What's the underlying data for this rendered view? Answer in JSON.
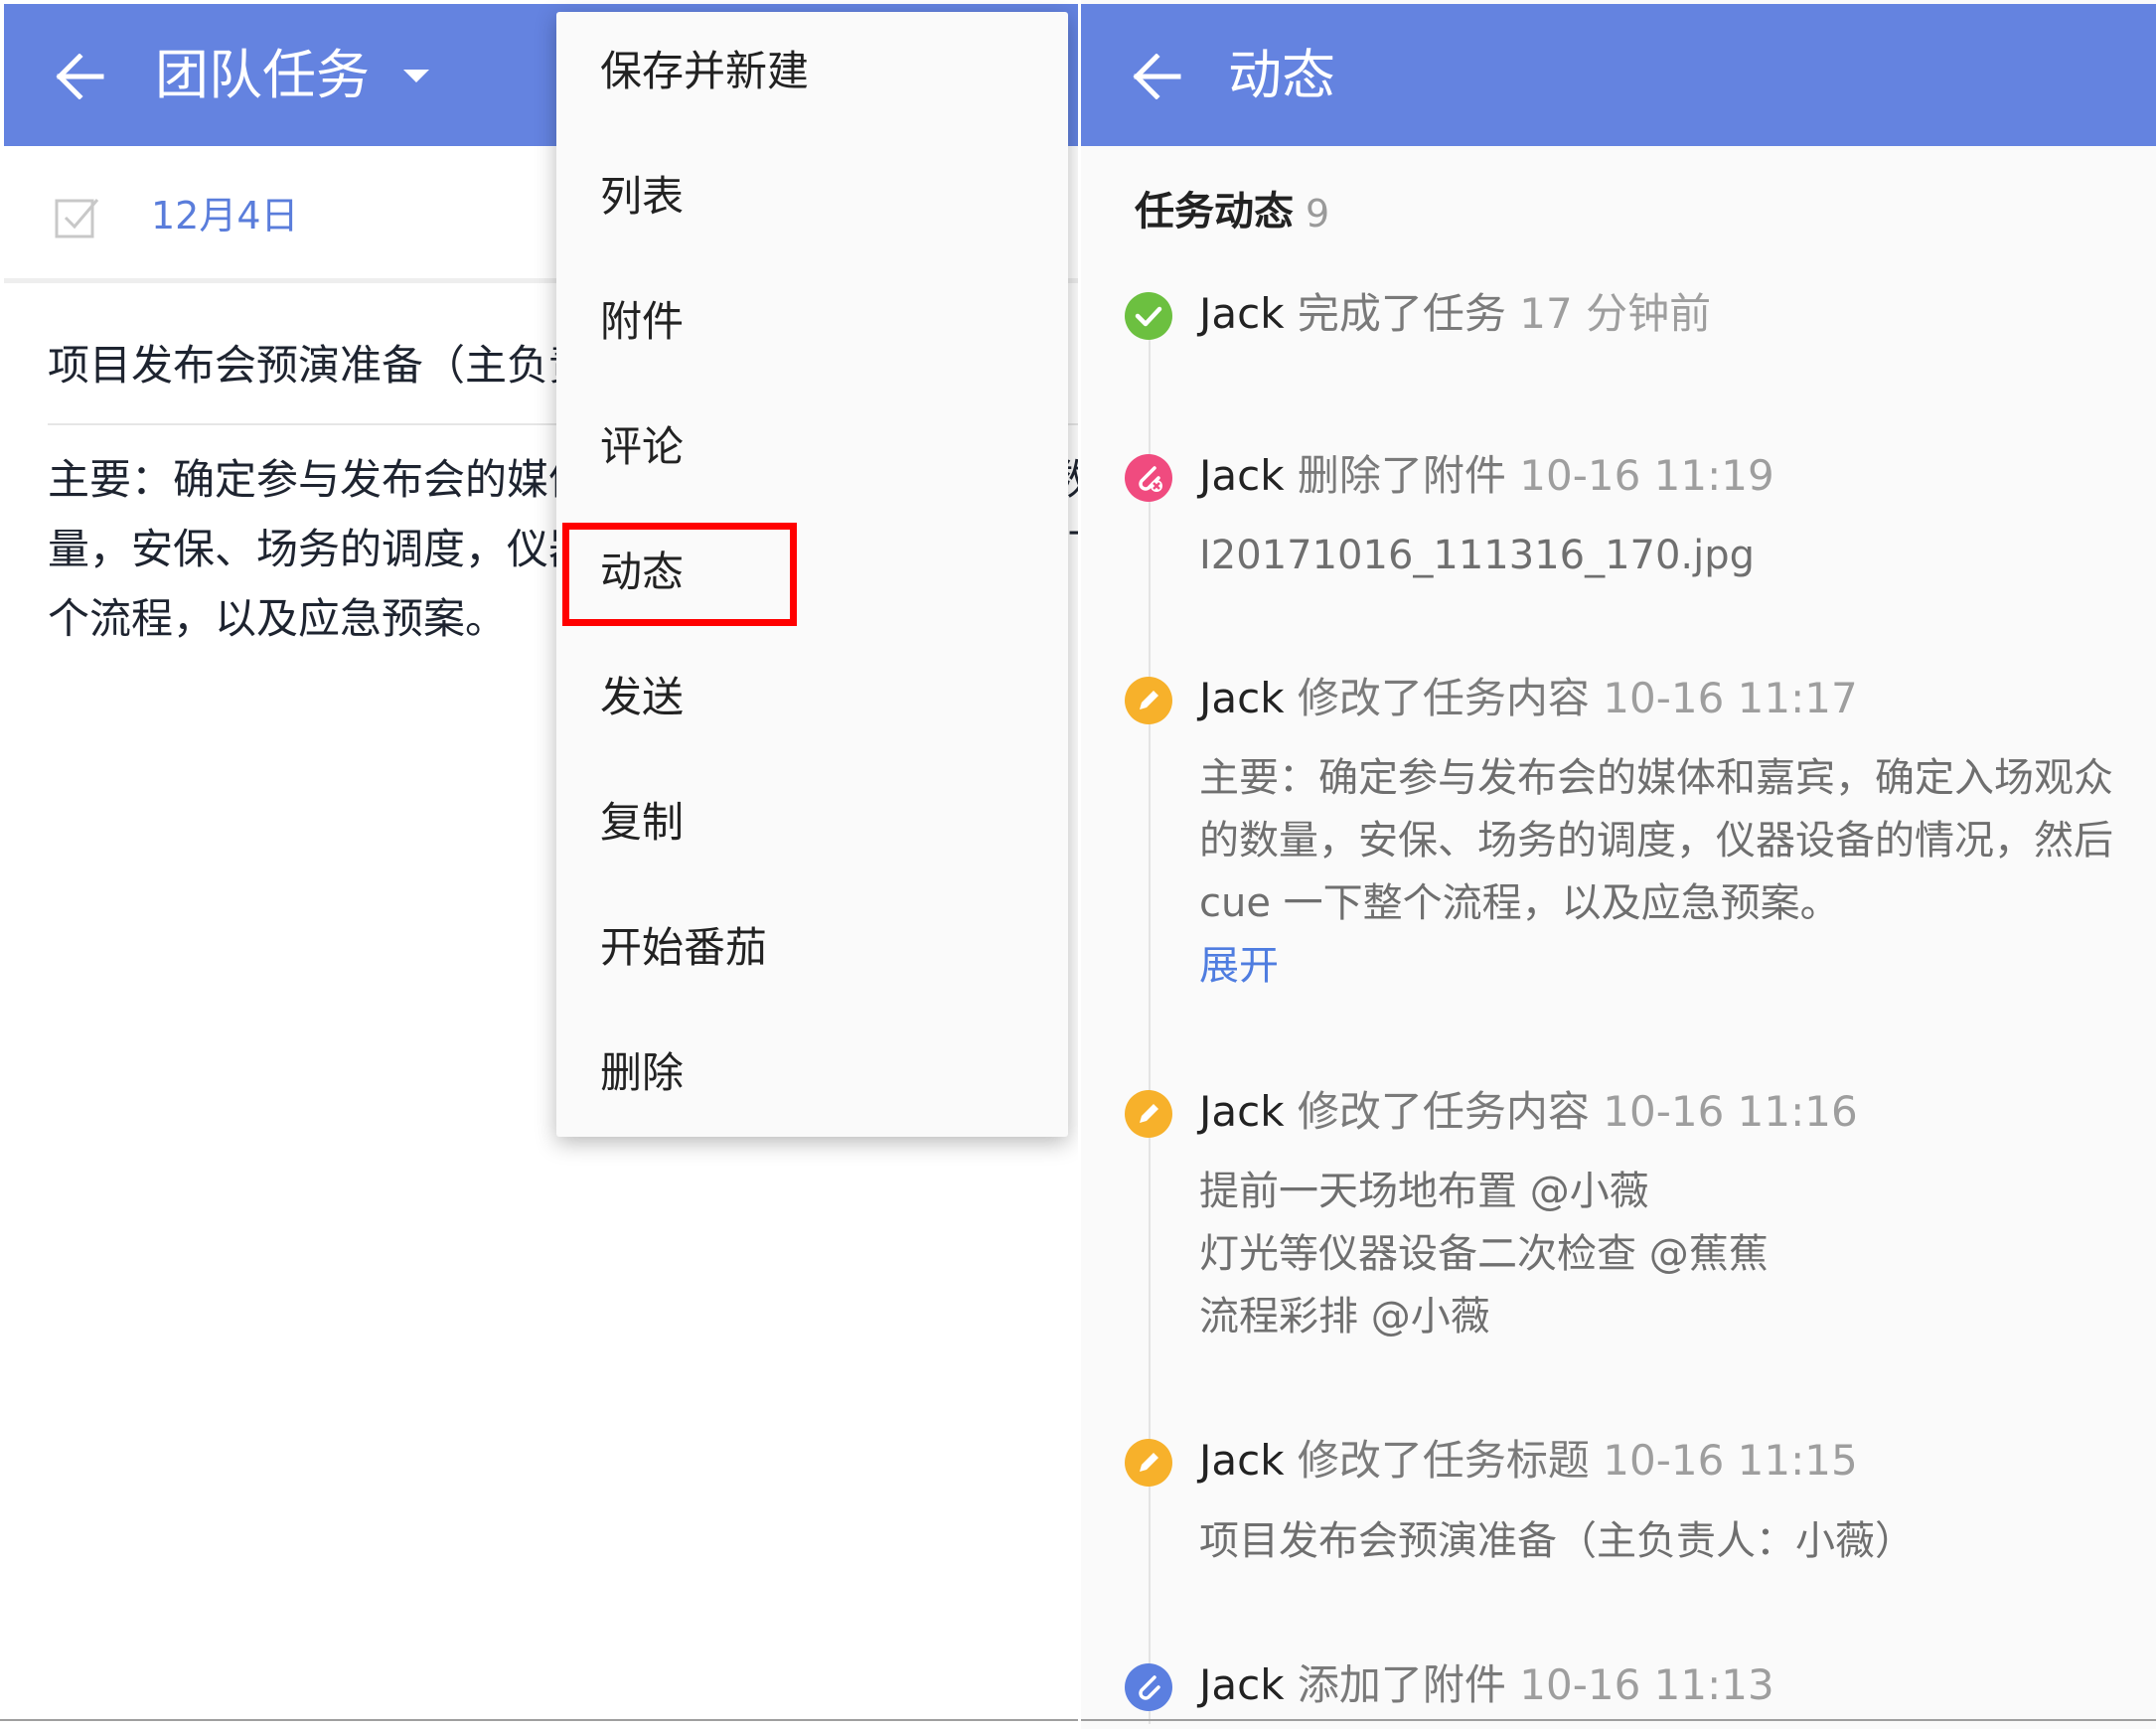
{
  "left": {
    "header": {
      "title": "团队任务"
    },
    "date": "12月4日",
    "task_title": "项目发布会预演准备（主负责人：小薇）",
    "task_description": "主要：确定参与发布会的媒体和嘉宾，确定入场观众的数量，安保、场务的调度，仪器设备的情况，然后 cue 一下整个流程，以及应急预案。",
    "menu": {
      "items": [
        "保存并新建",
        "列表",
        "附件",
        "评论",
        "动态",
        "发送",
        "复制",
        "开始番茄",
        "删除"
      ],
      "highlighted": "动态"
    }
  },
  "right": {
    "header": {
      "title": "动态"
    },
    "section": {
      "title": "任务动态",
      "count": "9"
    },
    "activities": [
      {
        "icon": "check-circle-icon",
        "color": "#6cc040",
        "user": "Jack",
        "action": "完成了任务",
        "time": "17 分钟前"
      },
      {
        "icon": "attachment-remove-icon",
        "color": "#f04b7f",
        "user": "Jack",
        "action": "删除了附件",
        "time": "10-16 11:19",
        "body": "I20171016_111316_170.jpg"
      },
      {
        "icon": "pencil-icon",
        "color": "#f7b12b",
        "user": "Jack",
        "action": "修改了任务内容",
        "time": "10-16 11:17",
        "body": "主要：确定参与发布会的媒体和嘉宾，确定入场观众的数量，安保、场务的调度，仪器设备的情况，然后 cue 一下整个流程，以及应急预案。",
        "link": "展开"
      },
      {
        "icon": "pencil-icon",
        "color": "#f7b12b",
        "user": "Jack",
        "action": "修改了任务内容",
        "time": "10-16 11:16",
        "body_lines": [
          "提前一天场地布置 @小薇",
          "灯光等仪器设备二次检查 @蕉蕉",
          "流程彩排 @小薇"
        ]
      },
      {
        "icon": "pencil-icon",
        "color": "#f7b12b",
        "user": "Jack",
        "action": "修改了任务标题",
        "time": "10-16 11:15",
        "body": "项目发布会预演准备（主负责人：小薇）"
      },
      {
        "icon": "attachment-icon",
        "color": "#5b7fe0",
        "user": "Jack",
        "action": "添加了附件",
        "time": "10-16 11:13"
      }
    ]
  }
}
